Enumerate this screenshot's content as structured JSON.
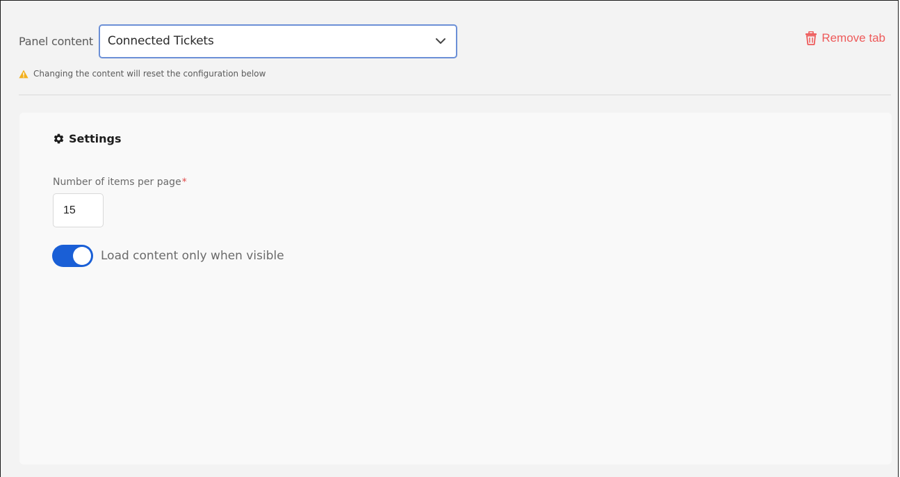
{
  "panel": {
    "label": "Panel content",
    "selected_value": "Connected Tickets",
    "warning_text": "Changing the content will reset the configuration below"
  },
  "remove_tab": {
    "label": "Remove tab",
    "color": "#ee5a5a"
  },
  "settings": {
    "title": "Settings",
    "items_per_page": {
      "label": "Number of items per page",
      "required_marker": "*",
      "value": "15"
    },
    "lazy_load": {
      "label": "Load content only when visible",
      "enabled": true
    }
  },
  "colors": {
    "accent": "#1a5fd6",
    "warning": "#f2b01e",
    "danger": "#ee5a5a"
  },
  "icons": {
    "chevron": "chevron-down-icon",
    "trash": "trash-icon",
    "warning": "warning-icon",
    "gear": "gear-icon"
  }
}
